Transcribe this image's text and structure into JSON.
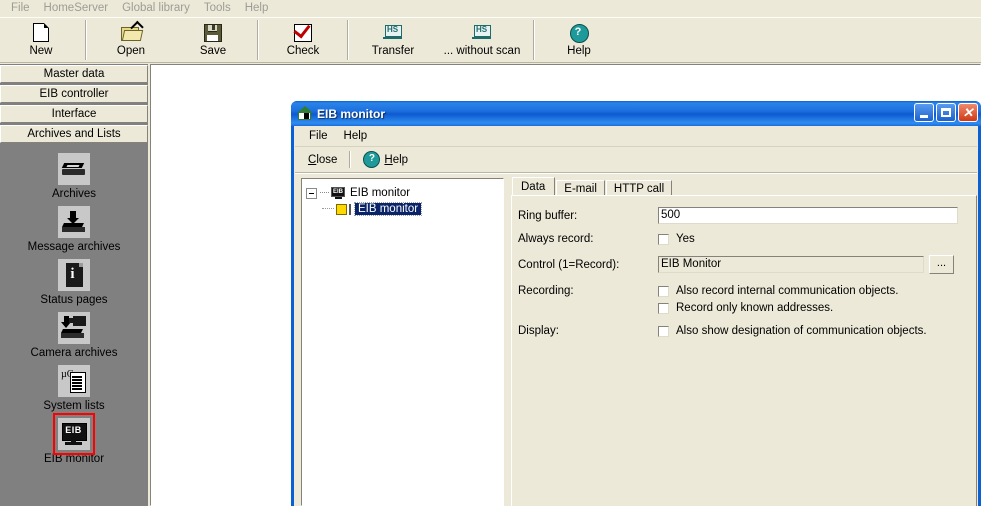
{
  "app": {
    "menu": [
      "File",
      "HomeServer",
      "Global library",
      "Tools",
      "Help"
    ],
    "toolbar": [
      {
        "label": "New",
        "icon": "new-page-icon"
      },
      {
        "label": "Open",
        "icon": "open-folder-icon"
      },
      {
        "label": "Save",
        "icon": "save-floppy-icon"
      },
      {
        "label": "Check",
        "icon": "check-icon"
      },
      {
        "label": "Transfer",
        "icon": "hs-transfer-icon"
      },
      {
        "label": "... without scan",
        "icon": "hs-transfer-icon"
      },
      {
        "label": "Help",
        "icon": "help-icon"
      }
    ]
  },
  "sidebar": {
    "buttons": [
      "Master data",
      "EIB controller",
      "Interface",
      "Archives and Lists"
    ],
    "active_button": "Archives and Lists",
    "items": [
      {
        "label": "Archives",
        "icon": "archive-box-icon",
        "selected": false
      },
      {
        "label": "Message archives",
        "icon": "message-archive-icon",
        "selected": false
      },
      {
        "label": "Status pages",
        "icon": "info-page-icon",
        "selected": false
      },
      {
        "label": "Camera archives",
        "icon": "camera-archive-icon",
        "selected": false
      },
      {
        "label": "System lists",
        "icon": "system-list-icon",
        "selected": false
      },
      {
        "label": "EIB monitor",
        "icon": "eib-monitor-icon",
        "selected": true
      }
    ],
    "selection_color": "#ff0000",
    "background_color": "#808080"
  },
  "dialog": {
    "title": "EIB monitor",
    "title_icon": "house-icon",
    "title_color": "#0a5fd4",
    "window_controls": [
      {
        "name": "minimize",
        "glyph": "_"
      },
      {
        "name": "maximize",
        "glyph": "□"
      },
      {
        "name": "close",
        "glyph": "×"
      }
    ],
    "menu": [
      "File",
      "Help"
    ],
    "toolbar": {
      "close_label": "Close",
      "close_accel": "C",
      "close_rest": "lose",
      "help_label": "Help",
      "help_accel": "H",
      "help_rest": "elp"
    },
    "tree": {
      "root": {
        "label": "EIB monitor",
        "icon": "eib-monitor-icon",
        "expanded": true
      },
      "children": [
        {
          "label": "EIB monitor",
          "icon": "yellow-square-icon",
          "selected": true
        }
      ]
    },
    "tabs": [
      {
        "label": "Data",
        "active": true
      },
      {
        "label": "E-mail",
        "active": false
      },
      {
        "label": "HTTP call",
        "active": false
      }
    ],
    "form": {
      "ring_buffer": {
        "label": "Ring buffer:",
        "value": "500"
      },
      "always_record": {
        "label": "Always record:",
        "checkbox_label": "Yes",
        "checked": false
      },
      "control": {
        "label": "Control (1=Record):",
        "value": "EIB Monitor",
        "browse_label": "...",
        "readonly": true
      },
      "recording": {
        "label": "Recording:",
        "options": [
          {
            "text": "Also record internal communication objects.",
            "checked": false
          },
          {
            "text": "Record only known addresses.",
            "checked": false
          }
        ]
      },
      "display": {
        "label": "Display:",
        "options": [
          {
            "text": "Also show designation of communication objects.",
            "checked": false
          }
        ]
      }
    }
  }
}
